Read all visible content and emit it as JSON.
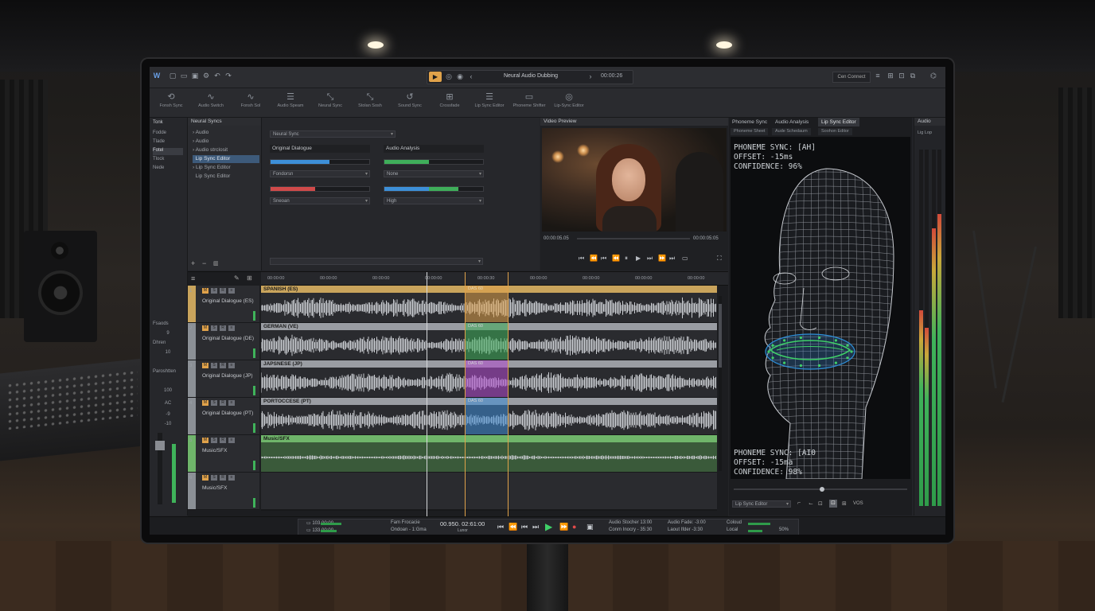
{
  "window": {
    "title": "Neural Audio Dubbing",
    "time": "00:00:26",
    "right_button": "Cen Connect"
  },
  "toolbar": {
    "tools": [
      {
        "label": "Fonsh Sync",
        "icon": "sync-icon"
      },
      {
        "label": "Audio Switch",
        "icon": "wave-icon"
      },
      {
        "label": "Fonsh Sol",
        "icon": "wave-icon"
      },
      {
        "label": "Audio Speam",
        "icon": "sliders-icon"
      },
      {
        "label": "Neural Sync",
        "icon": "cursor-icon"
      },
      {
        "label": "Stolan Sosh",
        "icon": "cursor-icon"
      },
      {
        "label": "Sound Sync",
        "icon": "undo-icon"
      },
      {
        "label": "Crossfade",
        "icon": "grid-icon"
      },
      {
        "label": "Lip Sync Editor",
        "icon": "sliders-icon"
      },
      {
        "label": "Phoneme Shifter",
        "icon": "screen-icon"
      },
      {
        "label": "Lip-Sync Editor",
        "icon": "target-icon"
      }
    ]
  },
  "leftcol": {
    "header": "Tonk",
    "items": [
      "Fodde",
      "Tlade",
      "Fotel",
      "Tlock",
      "Nede"
    ],
    "lower": [
      "Fsaods",
      "9",
      "Dhren",
      "10",
      "Paroshtten",
      "100",
      "AC",
      "-9",
      "-10"
    ]
  },
  "explorer": {
    "header": "Neural Syncs",
    "items": [
      "Audio",
      "Audio",
      "Audio strclosit",
      "Lip Sync Editor",
      "Lip Sync Editor",
      "Lip Sync Editor"
    ]
  },
  "neural": {
    "select": "Neural Sync",
    "left_label": "Original Dialogue",
    "right_label": "Audio Analysis",
    "dd1": "Fondorsn",
    "dd2": "None",
    "dd3": "Sneoan",
    "dd4": "High",
    "meter1": 0.6,
    "meter2": 0.45,
    "meter3": 0.45,
    "meter4": 0.75
  },
  "video": {
    "header": "Video Preview",
    "time_left": "00:00:05.05",
    "time_right": "00:00:05:05"
  },
  "phoneme": {
    "tabs": [
      "Phoneme Sync",
      "Audio Analysis",
      "Lip Sync Editor"
    ],
    "subtabs": [
      "Phoneme Sheet",
      "Aude Schedaum",
      "Soohon Editor"
    ],
    "top": {
      "line1": "PHONEME SYNC: [AH]",
      "line2": "OFFSET: -15ms",
      "line3": "CONFIDENCE: 96%"
    },
    "bottom": {
      "line1": "PHONEME SYNC: [AI0",
      "line2": "OFFSET: -15ma",
      "line3": "CONFIDENCE: 98%"
    },
    "footer_select": "Lip Sync Editor",
    "footer_value": "VOS"
  },
  "audio": {
    "header": "Audio",
    "sub": "Lig Lop",
    "meters": [
      0.55,
      0.5,
      0.78,
      0.82
    ]
  },
  "timeline": {
    "ticks": [
      "00:00:00",
      "00:00:00",
      "00:00:00",
      "00:00:00",
      "00:00:30",
      "00:00:00",
      "00:00:00",
      "00:00:00",
      "00:00:00"
    ],
    "tracks": [
      {
        "num": "1",
        "name": "Original Dialogue (ES)",
        "lane": "SPANISH (ES)",
        "color": "#c9a45c",
        "region_color": "#e0a24a",
        "region_label": "DAS 60"
      },
      {
        "num": "2",
        "name": "Original Dialogue (DE)",
        "lane": "GERMAN (VE)",
        "color": "#8b9096",
        "region_color": "#3fae5a",
        "region_label": "DAS 60"
      },
      {
        "num": "3",
        "name": "Original Dialogue (JP)",
        "lane": "JAPSNESE (JP)",
        "color": "#8b9096",
        "region_color": "#b34ad0",
        "region_label": "DAS 60"
      },
      {
        "num": "4",
        "name": "Original Dialogue (PT)",
        "lane": "PORTOCCESE (PT)",
        "color": "#8b9096",
        "region_color": "#3e8dd6",
        "region_label": "DAS 60"
      },
      {
        "num": "5",
        "name": "Music/SFX",
        "lane": "Music/SFX",
        "color": "#6fb56a",
        "region_color": "",
        "region_label": ""
      },
      {
        "num": "6",
        "name": "Music/SFX",
        "lane": "",
        "color": "#8b9096",
        "region_color": "",
        "region_label": ""
      }
    ]
  },
  "transport": {
    "l1": "103  00:00",
    "l2": "133  00:00",
    "fp": "Fam Frocacie",
    "om": "Ondoan - 1:Gma",
    "time": "00.950. 02:61:00",
    "time_sub": "Lunor",
    "r1": "Audio Stocher  13:00",
    "r2": "Conm Inocry  - 35:30",
    "r3": "Audio Fade:  -3:00",
    "r4": "Laout Ifder  -3:30",
    "r5": "Coloud",
    "r6": "Local",
    "pct": "50%"
  }
}
